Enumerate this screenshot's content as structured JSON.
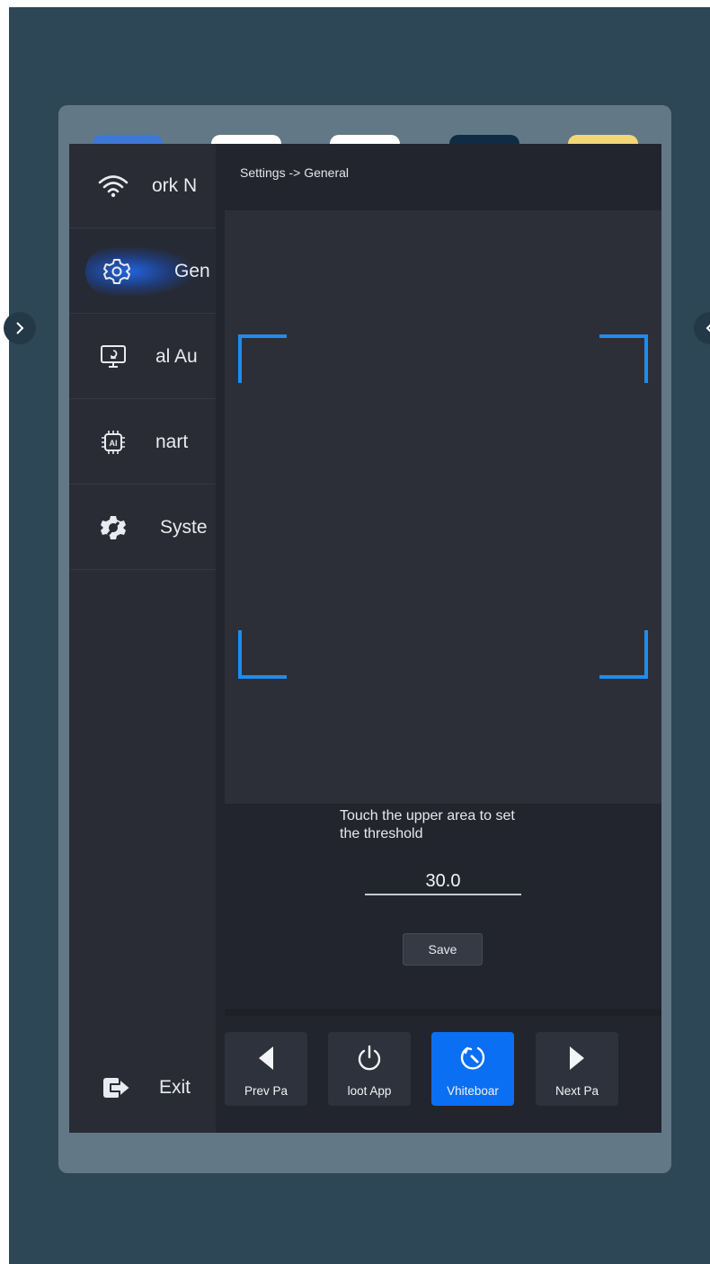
{
  "sidebar": {
    "items": [
      {
        "label": "ork  N",
        "icon": "wifi-icon"
      },
      {
        "label": "Gen",
        "icon": "settings-gear-icon"
      },
      {
        "label": "al  Au",
        "icon": "monitor-icon"
      },
      {
        "label": "nart",
        "icon": "ai-chip-icon"
      },
      {
        "label": "Syste",
        "icon": "system-wrench-gear-icon"
      }
    ],
    "exit_label": "Exit"
  },
  "main": {
    "breadcrumb": "Settings -> General",
    "threshold_hint_line1": "Touch the upper area to set",
    "threshold_hint_line2": "the threshold",
    "threshold_value": "30.0",
    "save_label": "Save"
  },
  "dock": {
    "items": [
      {
        "label": "Prev Pa",
        "icon": "triangle-left-icon"
      },
      {
        "label": "loot App",
        "icon": "power-icon"
      },
      {
        "label": "Vhiteboar",
        "icon": "whiteboard-icon"
      },
      {
        "label": "Next Pa",
        "icon": "triangle-right-icon"
      }
    ]
  },
  "colors": {
    "background": "#2d4756",
    "panel": "#627886",
    "window": "#22252d",
    "accent": "#1c8df0",
    "active_dock": "#0a6ff2"
  },
  "app_tiles": [
    {
      "color": "#3d78d8"
    },
    {
      "color": "#ffffff"
    },
    {
      "color": "#ffffff"
    },
    {
      "color": "#0f2c44"
    },
    {
      "color": "#f3d676"
    }
  ]
}
